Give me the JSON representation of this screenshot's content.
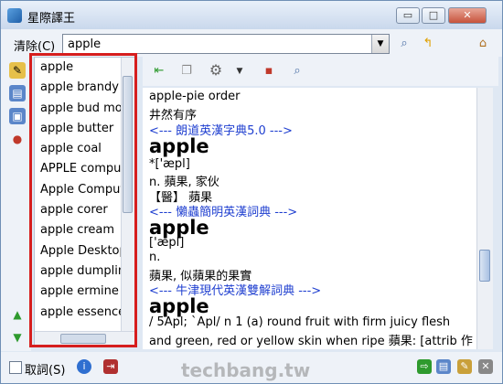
{
  "window": {
    "title": "星際譯王"
  },
  "window_controls": {
    "minimize": "▭",
    "maximize": "□",
    "close": "✕"
  },
  "search": {
    "clear_label": "清除(C)",
    "query": "apple"
  },
  "word_list": [
    "apple",
    "apple brandy",
    "apple bud mot",
    "apple butter",
    "apple coal",
    "APPLE comput",
    "Apple Comput",
    "apple corer",
    "apple cream",
    "Apple Desktop",
    "apple dumpling",
    "apple ermine n",
    "apple essence"
  ],
  "content": {
    "lines": [
      {
        "kind": "text",
        "text": "apple-pie order"
      },
      {
        "kind": "text",
        "text": "井然有序"
      },
      {
        "kind": "src",
        "text": "<--- 朗道英漢字典5.0 --->"
      },
      {
        "kind": "hw",
        "text": "apple"
      },
      {
        "kind": "text",
        "text": "*['æpl]"
      },
      {
        "kind": "text",
        "text": "n. 蘋果, 家伙"
      },
      {
        "kind": "text",
        "text": "【醫】 蘋果"
      },
      {
        "kind": "src",
        "text": "<--- 懶蟲簡明英漢詞典 --->"
      },
      {
        "kind": "hw",
        "text": "apple"
      },
      {
        "kind": "text",
        "text": "['æpl]"
      },
      {
        "kind": "text",
        "text": "n."
      },
      {
        "kind": "text",
        "text": "蘋果, 似蘋果的果實"
      },
      {
        "kind": "src",
        "text": "<--- 牛津現代英漢雙解詞典 --->"
      },
      {
        "kind": "hw",
        "text": "apple"
      },
      {
        "kind": "text",
        "text": "/ 5Apl; `Apl/ n  1 (a) round fruit with firm juicy flesh"
      },
      {
        "kind": "text",
        "text": "and green, red or yellow skin when ripe 蘋果: [attrib 作"
      }
    ]
  },
  "status": {
    "cancel_label": "取詞(S)"
  },
  "watermark": "techbang.tw",
  "colors": {
    "highlight_border": "#d61e1e",
    "dict_source": "#1f3fd0"
  }
}
